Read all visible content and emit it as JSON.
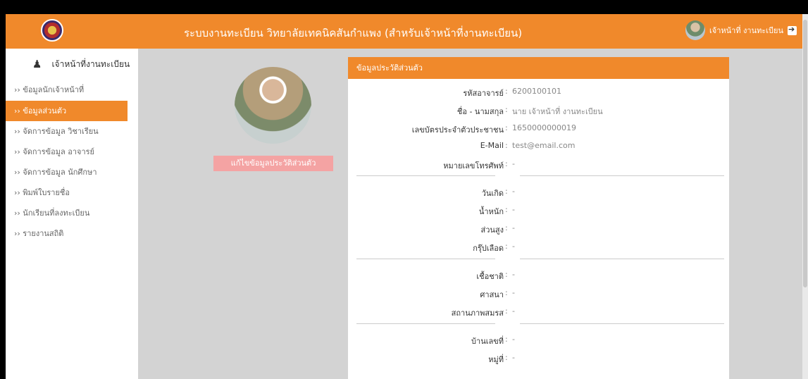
{
  "header": {
    "title": "ระบบงานทะเบียน วิทยาลัยเทคนิคสันกำแพง (สำหรับเจ้าหน้าที่งานทะเบียน)",
    "user_name": "เจ้าหน้าที่ งานทะเบียน"
  },
  "sidebar": {
    "user_label": "เจ้าหน้าที่งานทะเบียน",
    "items": [
      {
        "label": "›› ข้อมูลนักเจ้าหน้าที่"
      },
      {
        "label": "›› ข้อมูลส่วนตัว"
      },
      {
        "label": "›› จัดการข้อมูล วิชาเรียน"
      },
      {
        "label": "›› จัดการข้อมูล อาจารย์"
      },
      {
        "label": "›› จัดการข้อมูล นักศึกษา"
      },
      {
        "label": "›› พิมพ์ใบรายชื่อ"
      },
      {
        "label": "›› นักเรียนที่ลงทะเบียน"
      },
      {
        "label": "›› รายงานสถิติ"
      }
    ]
  },
  "profile": {
    "edit_button": "แก้ไขข้อมูลประวัติส่วนตัว"
  },
  "card": {
    "title": "ข้อมูลประวัติส่วนตัว",
    "rows": [
      {
        "label": "รหัสอาจารย์",
        "value": "6200100101"
      },
      {
        "label": "ชื่อ - นามสกุล",
        "value": "นาย เจ้าหน้าที่ งานทะเบียน"
      },
      {
        "label": "เลขบัตรประจำตัวประชาชน",
        "value": "1650000000019"
      },
      {
        "label": "E-Mail",
        "value": "test@email.com"
      },
      {
        "label": "หมายเลขโทรศัพท์",
        "value": "-"
      },
      {
        "label": "วันเกิด",
        "value": "-"
      },
      {
        "label": "น้ำหนัก",
        "value": "-"
      },
      {
        "label": "ส่วนสูง",
        "value": "-"
      },
      {
        "label": "กรุ๊ปเลือด",
        "value": "-"
      },
      {
        "label": "เชื้อชาติ",
        "value": "-"
      },
      {
        "label": "ศาสนา",
        "value": "-"
      },
      {
        "label": "สถานภาพสมรส",
        "value": "-"
      },
      {
        "label": "บ้านเลขที่",
        "value": "-"
      },
      {
        "label": "หมู่ที่",
        "value": "-"
      }
    ]
  },
  "colors": {
    "accent": "#f0892b",
    "edit_button": "#f4a3a3",
    "background": "#d3d3d3"
  }
}
